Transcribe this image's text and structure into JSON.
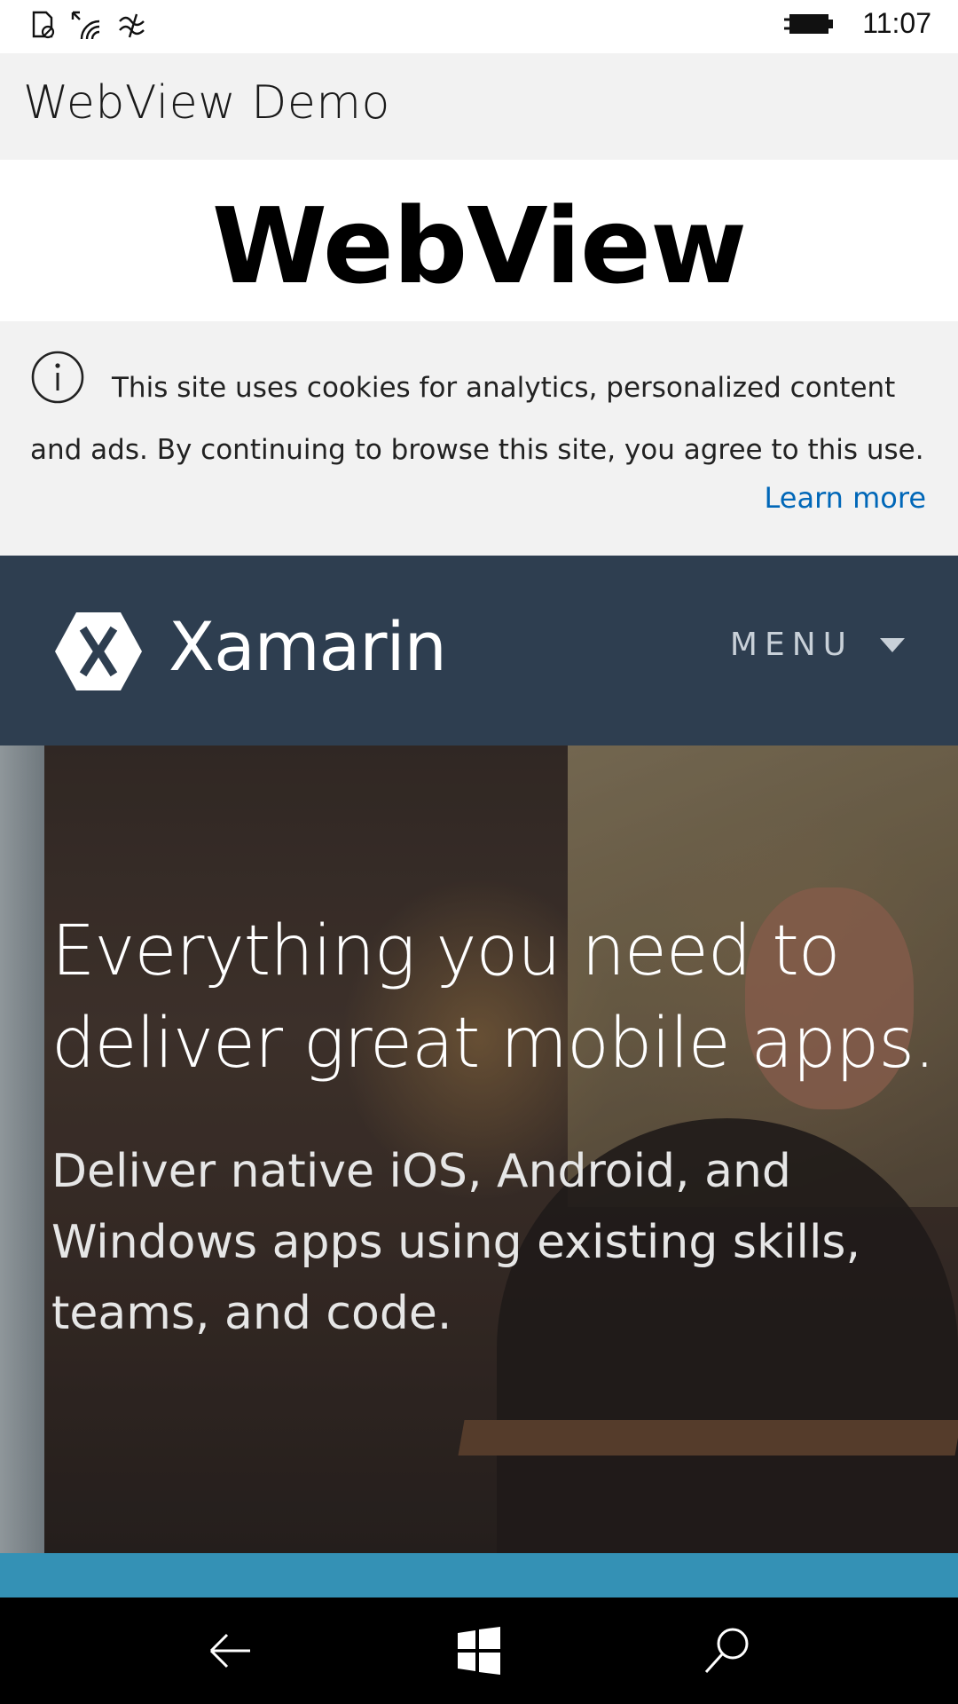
{
  "status_bar": {
    "time": "11:07",
    "icons": [
      "no-sim-icon",
      "wifi-icon",
      "data-transfer-icon",
      "battery-charging-icon"
    ]
  },
  "app": {
    "title": "WebView Demo"
  },
  "page": {
    "heading": "WebView",
    "cookie_notice": {
      "text": "This site uses cookies for analytics, personalized content and ads. By continuing to browse this site, you agree to this use.",
      "link": "Learn more",
      "icon": "info-icon"
    },
    "site_nav": {
      "brand": "Xamarin",
      "menu_label": "MENU",
      "menu_icon": "caret-down-icon",
      "logo_icon": "xamarin-logo-icon"
    },
    "hero": {
      "title": "Everything you need to deliver great mobile apps.",
      "subtitle": "Deliver native iOS, Android, and Windows apps using existing skills, teams, and code."
    }
  },
  "system_nav": {
    "buttons": [
      "back-icon",
      "windows-icon",
      "search-icon"
    ]
  },
  "colors": {
    "navbar": "#2e3e50",
    "link": "#0067b8",
    "accent_strip": "#3491b5",
    "cookie_bg": "#f2f2f2"
  }
}
